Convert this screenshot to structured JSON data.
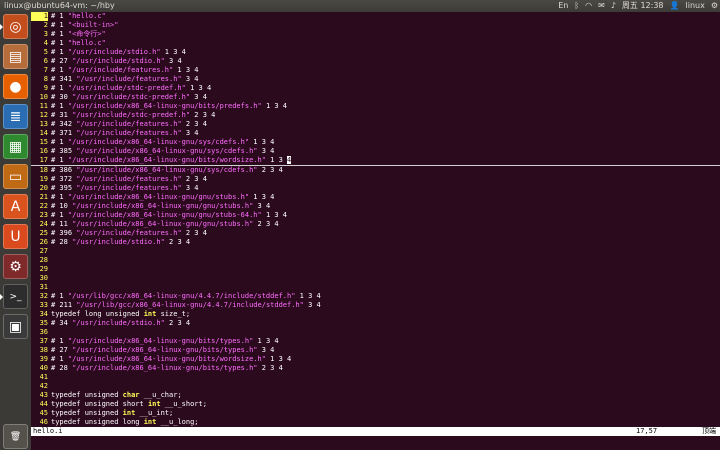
{
  "window": {
    "title": "linux@ubuntu64-vm: ~/hby"
  },
  "tray": {
    "keyboard": "En",
    "clock": "周五 12:38",
    "user": "linux"
  },
  "launcher": {
    "items": [
      {
        "name": "dash-icon",
        "color": "#c24e1e",
        "glyph": "◎"
      },
      {
        "name": "files-icon",
        "color": "#b66d3c",
        "glyph": "▤"
      },
      {
        "name": "firefox-icon",
        "color": "#e66000",
        "glyph": "●"
      },
      {
        "name": "writer-icon",
        "color": "#2a6db3",
        "glyph": "≣"
      },
      {
        "name": "calc-icon",
        "color": "#2f8a2f",
        "glyph": "▦"
      },
      {
        "name": "impress-icon",
        "color": "#c06a16",
        "glyph": "▭"
      },
      {
        "name": "software-center-icon",
        "color": "#d9531e",
        "glyph": "A"
      },
      {
        "name": "ubuntu-one-icon",
        "color": "#d94a1e",
        "glyph": "U"
      },
      {
        "name": "settings-icon",
        "color": "#7f2a2a",
        "glyph": "⚙"
      },
      {
        "name": "terminal-icon",
        "color": "#2d2d2d",
        "glyph": ">_"
      },
      {
        "name": "workspace-icon",
        "color": "#3a3a3a",
        "glyph": "▣"
      },
      {
        "name": "trash-icon",
        "color": "#55524c",
        "glyph": "🗑"
      }
    ]
  },
  "editor": {
    "lines": [
      {
        "n": "1",
        "t": [
          [
            "# 1 ",
            ""
          ],
          [
            "\"hello.c\"",
            "s"
          ]
        ]
      },
      {
        "n": "2",
        "t": [
          [
            "# 1 ",
            ""
          ],
          [
            "\"<built-in>\"",
            "s"
          ]
        ]
      },
      {
        "n": "3",
        "t": [
          [
            "# 1 ",
            ""
          ],
          [
            "\"<命令行>\"",
            "s"
          ]
        ]
      },
      {
        "n": "4",
        "t": [
          [
            "# 1 ",
            ""
          ],
          [
            "\"hello.c\"",
            "s"
          ]
        ]
      },
      {
        "n": "5",
        "t": [
          [
            "# 1 ",
            ""
          ],
          [
            "\"/usr/include/stdio.h\"",
            "s"
          ],
          [
            " 1 3 4",
            ""
          ]
        ]
      },
      {
        "n": "6",
        "t": [
          [
            "# 27 ",
            ""
          ],
          [
            "\"/usr/include/stdio.h\"",
            "s"
          ],
          [
            " 3 4",
            ""
          ]
        ]
      },
      {
        "n": "7",
        "t": [
          [
            "# 1 ",
            ""
          ],
          [
            "\"/usr/include/features.h\"",
            "s"
          ],
          [
            " 1 3 4",
            ""
          ]
        ]
      },
      {
        "n": "8",
        "t": [
          [
            "# 341 ",
            ""
          ],
          [
            "\"/usr/include/features.h\"",
            "s"
          ],
          [
            " 3 4",
            ""
          ]
        ]
      },
      {
        "n": "9",
        "t": [
          [
            "# 1 ",
            ""
          ],
          [
            "\"/usr/include/stdc-predef.h\"",
            "s"
          ],
          [
            " 1 3 4",
            ""
          ]
        ]
      },
      {
        "n": "10",
        "t": [
          [
            "# 30 ",
            ""
          ],
          [
            "\"/usr/include/stdc-predef.h\"",
            "s"
          ],
          [
            " 3 4",
            ""
          ]
        ]
      },
      {
        "n": "11",
        "t": [
          [
            "# 1 ",
            ""
          ],
          [
            "\"/usr/include/x86_64-linux-gnu/bits/predefs.h\"",
            "s"
          ],
          [
            " 1 3 4",
            ""
          ]
        ]
      },
      {
        "n": "12",
        "t": [
          [
            "# 31 ",
            ""
          ],
          [
            "\"/usr/include/stdc-predef.h\"",
            "s"
          ],
          [
            " 2 3 4",
            ""
          ]
        ]
      },
      {
        "n": "13",
        "t": [
          [
            "# 342 ",
            ""
          ],
          [
            "\"/usr/include/features.h\"",
            "s"
          ],
          [
            " 2 3 4",
            ""
          ]
        ]
      },
      {
        "n": "14",
        "t": [
          [
            "# 371 ",
            ""
          ],
          [
            "\"/usr/include/features.h\"",
            "s"
          ],
          [
            " 3 4",
            ""
          ]
        ]
      },
      {
        "n": "15",
        "t": [
          [
            "# 1 ",
            ""
          ],
          [
            "\"/usr/include/x86_64-linux-gnu/sys/cdefs.h\"",
            "s"
          ],
          [
            " 1 3 4",
            ""
          ]
        ]
      },
      {
        "n": "16",
        "t": [
          [
            "# 385 ",
            ""
          ],
          [
            "\"/usr/include/x86_64-linux-gnu/sys/cdefs.h\"",
            "s"
          ],
          [
            " 3 4",
            ""
          ]
        ]
      },
      {
        "n": "17",
        "t": [
          [
            "# 1 ",
            ""
          ],
          [
            "\"/usr/include/x86_64-linux-gnu/bits/wordsize.h\"",
            "s"
          ],
          [
            " 1 3 ",
            ""
          ],
          [
            "4",
            "cur"
          ]
        ],
        "current": true
      },
      {
        "n": "18",
        "t": [
          [
            "# 386 ",
            ""
          ],
          [
            "\"/usr/include/x86_64-linux-gnu/sys/cdefs.h\"",
            "s"
          ],
          [
            " 2 3 4",
            ""
          ]
        ]
      },
      {
        "n": "19",
        "t": [
          [
            "# 372 ",
            ""
          ],
          [
            "\"/usr/include/features.h\"",
            "s"
          ],
          [
            " 2 3 4",
            ""
          ]
        ]
      },
      {
        "n": "20",
        "t": [
          [
            "# 395 ",
            ""
          ],
          [
            "\"/usr/include/features.h\"",
            "s"
          ],
          [
            " 3 4",
            ""
          ]
        ]
      },
      {
        "n": "21",
        "t": [
          [
            "# 1 ",
            ""
          ],
          [
            "\"/usr/include/x86_64-linux-gnu/gnu/stubs.h\"",
            "s"
          ],
          [
            " 1 3 4",
            ""
          ]
        ]
      },
      {
        "n": "22",
        "t": [
          [
            "# 10 ",
            ""
          ],
          [
            "\"/usr/include/x86_64-linux-gnu/gnu/stubs.h\"",
            "s"
          ],
          [
            " 3 4",
            ""
          ]
        ]
      },
      {
        "n": "23",
        "t": [
          [
            "# 1 ",
            ""
          ],
          [
            "\"/usr/include/x86_64-linux-gnu/gnu/stubs-64.h\"",
            "s"
          ],
          [
            " 1 3 4",
            ""
          ]
        ]
      },
      {
        "n": "24",
        "t": [
          [
            "# 11 ",
            ""
          ],
          [
            "\"/usr/include/x86_64-linux-gnu/gnu/stubs.h\"",
            "s"
          ],
          [
            " 2 3 4",
            ""
          ]
        ]
      },
      {
        "n": "25",
        "t": [
          [
            "# 396 ",
            ""
          ],
          [
            "\"/usr/include/features.h\"",
            "s"
          ],
          [
            " 2 3 4",
            ""
          ]
        ]
      },
      {
        "n": "26",
        "t": [
          [
            "# 28 ",
            ""
          ],
          [
            "\"/usr/include/stdio.h\"",
            "s"
          ],
          [
            " 2 3 4",
            ""
          ]
        ]
      },
      {
        "n": "27",
        "t": []
      },
      {
        "n": "28",
        "t": []
      },
      {
        "n": "29",
        "t": []
      },
      {
        "n": "30",
        "t": []
      },
      {
        "n": "31",
        "t": []
      },
      {
        "n": "32",
        "t": [
          [
            "# 1 ",
            ""
          ],
          [
            "\"/usr/lib/gcc/x86_64-linux-gnu/4.4.7/include/stddef.h\"",
            "s"
          ],
          [
            " 1 3 4",
            ""
          ]
        ]
      },
      {
        "n": "33",
        "t": [
          [
            "# 211 ",
            ""
          ],
          [
            "\"/usr/lib/gcc/x86_64-linux-gnu/4.4.7/include/stddef.h\"",
            "s"
          ],
          [
            " 3 4",
            ""
          ]
        ]
      },
      {
        "n": "34",
        "t": [
          [
            "typedef long unsigned ",
            ""
          ],
          [
            "int",
            "k"
          ],
          [
            " size_t;",
            ""
          ]
        ]
      },
      {
        "n": "35",
        "t": [
          [
            "# 34 ",
            ""
          ],
          [
            "\"/usr/include/stdio.h\"",
            "s"
          ],
          [
            " 2 3 4",
            ""
          ]
        ]
      },
      {
        "n": "36",
        "t": []
      },
      {
        "n": "37",
        "t": [
          [
            "# 1 ",
            ""
          ],
          [
            "\"/usr/include/x86_64-linux-gnu/bits/types.h\"",
            "s"
          ],
          [
            " 1 3 4",
            ""
          ]
        ]
      },
      {
        "n": "38",
        "t": [
          [
            "# 27 ",
            ""
          ],
          [
            "\"/usr/include/x86_64-linux-gnu/bits/types.h\"",
            "s"
          ],
          [
            " 3 4",
            ""
          ]
        ]
      },
      {
        "n": "39",
        "t": [
          [
            "# 1 ",
            ""
          ],
          [
            "\"/usr/include/x86_64-linux-gnu/bits/wordsize.h\"",
            "s"
          ],
          [
            " 1 3 4",
            ""
          ]
        ]
      },
      {
        "n": "40",
        "t": [
          [
            "# 28 ",
            ""
          ],
          [
            "\"/usr/include/x86_64-linux-gnu/bits/types.h\"",
            "s"
          ],
          [
            " 2 3 4",
            ""
          ]
        ]
      },
      {
        "n": "41",
        "t": []
      },
      {
        "n": "42",
        "t": []
      },
      {
        "n": "43",
        "t": [
          [
            "typedef unsigned ",
            ""
          ],
          [
            "char",
            "k"
          ],
          [
            " __u_char;",
            ""
          ]
        ]
      },
      {
        "n": "44",
        "t": [
          [
            "typedef unsigned short ",
            ""
          ],
          [
            "int",
            "k"
          ],
          [
            " __u_short;",
            ""
          ]
        ]
      },
      {
        "n": "45",
        "t": [
          [
            "typedef unsigned ",
            ""
          ],
          [
            "int",
            "k"
          ],
          [
            " __u_int;",
            ""
          ]
        ]
      },
      {
        "n": "46",
        "t": [
          [
            "typedef unsigned long ",
            ""
          ],
          [
            "int",
            "k"
          ],
          [
            " __u_long;",
            ""
          ]
        ]
      }
    ]
  },
  "statusline": {
    "filename": "hello.i",
    "position": "17,57",
    "scroll": "顶端"
  }
}
